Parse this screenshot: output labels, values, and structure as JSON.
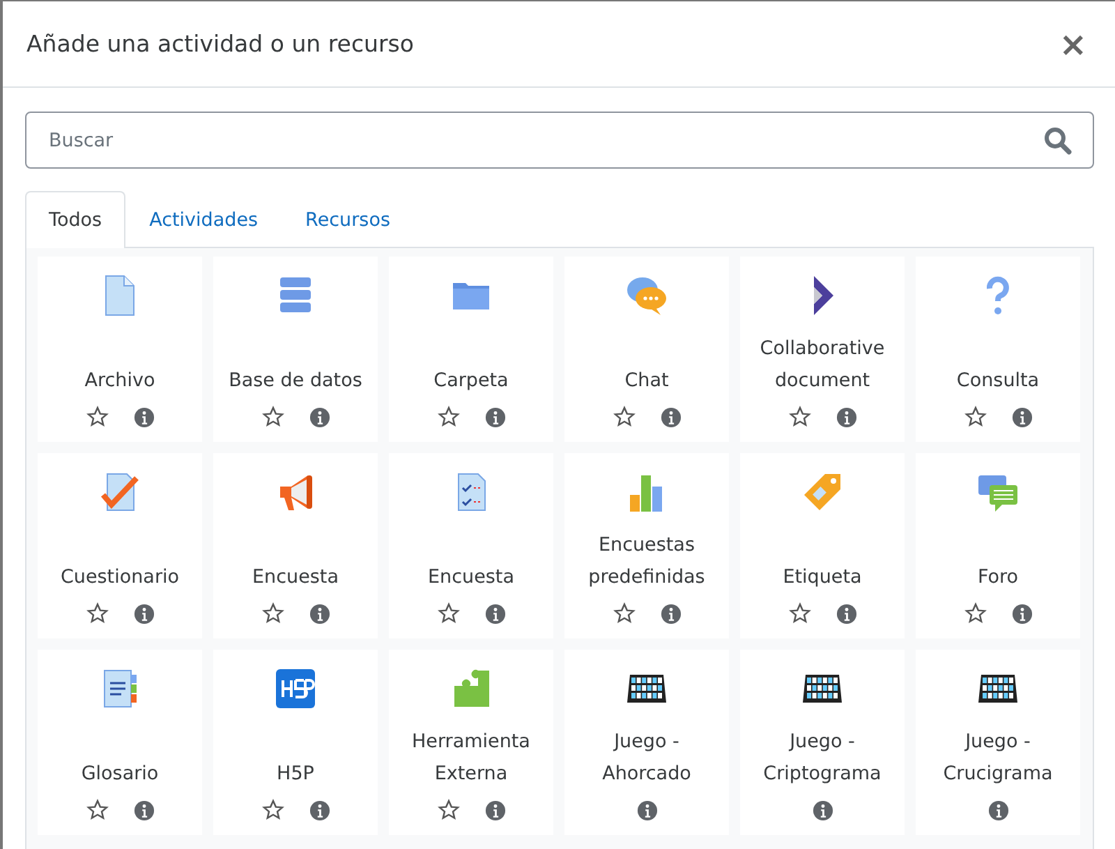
{
  "dialog": {
    "title": "Añade una actividad o un recurso",
    "close": "×"
  },
  "search": {
    "placeholder": "Buscar"
  },
  "tabs": [
    {
      "label": "Todos",
      "selected": true
    },
    {
      "label": "Actividades",
      "selected": false
    },
    {
      "label": "Recursos",
      "selected": false
    }
  ],
  "items": [
    {
      "kind": "file",
      "label": "Archivo",
      "star": true
    },
    {
      "kind": "database",
      "label": "Base de datos",
      "star": true
    },
    {
      "kind": "folder",
      "label": "Carpeta",
      "star": true
    },
    {
      "kind": "chat",
      "label": "Chat",
      "star": true
    },
    {
      "kind": "collab",
      "label": "Collaborative document",
      "star": true
    },
    {
      "kind": "question",
      "label": "Consulta",
      "star": true
    },
    {
      "kind": "quiz",
      "label": "Cuestionario",
      "star": true
    },
    {
      "kind": "megaphone",
      "label": "Encuesta",
      "star": true
    },
    {
      "kind": "survey",
      "label": "Encuesta",
      "star": true
    },
    {
      "kind": "chart",
      "label": "Encuestas predefinidas",
      "star": true
    },
    {
      "kind": "tag",
      "label": "Etiqueta",
      "star": true
    },
    {
      "kind": "forum",
      "label": "Foro",
      "star": true
    },
    {
      "kind": "glossary",
      "label": "Glosario",
      "star": true
    },
    {
      "kind": "h5p",
      "label": "H5P",
      "star": true
    },
    {
      "kind": "puzzle",
      "label": "Herramienta Externa",
      "star": true
    },
    {
      "kind": "board",
      "label": "Juego - Ahorcado",
      "star": false
    },
    {
      "kind": "board",
      "label": "Juego - Criptograma",
      "star": false
    },
    {
      "kind": "board",
      "label": "Juego - Crucigrama",
      "star": false
    }
  ]
}
